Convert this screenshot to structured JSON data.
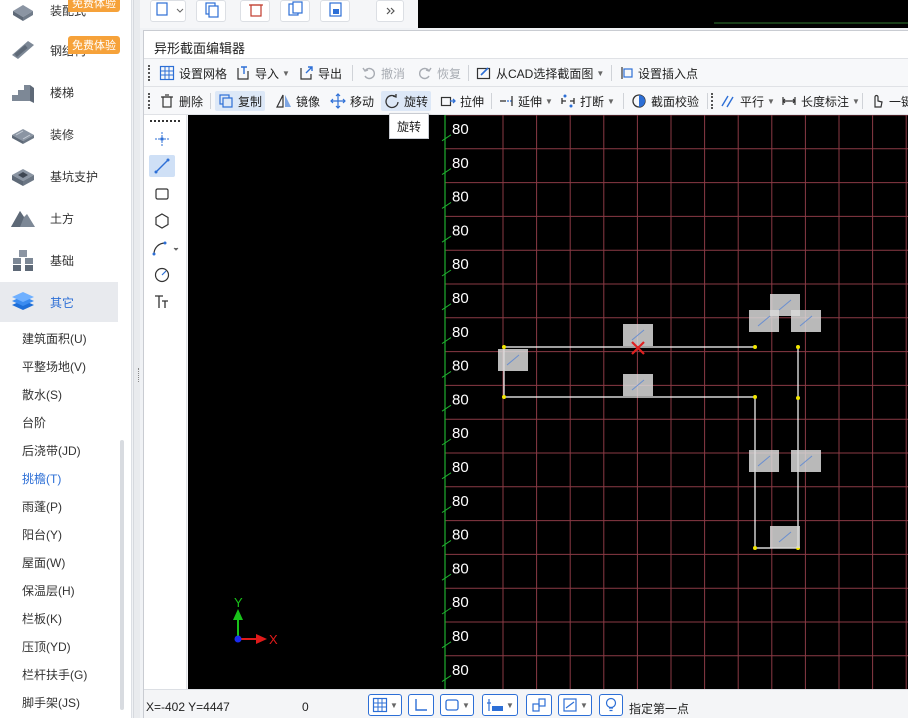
{
  "sidebar": {
    "categories": [
      {
        "label": "装配式",
        "badge": "免费体验",
        "icon": "prefab-icon"
      },
      {
        "label": "钢结构",
        "badge": "免费体验",
        "icon": "steel-icon"
      },
      {
        "label": "楼梯",
        "icon": "stairs-icon"
      },
      {
        "label": "装修",
        "icon": "decoration-icon"
      },
      {
        "label": "基坑支护",
        "icon": "foundation-pit-icon"
      },
      {
        "label": "土方",
        "icon": "earthwork-icon"
      },
      {
        "label": "基础",
        "icon": "foundation-icon"
      },
      {
        "label": "其它",
        "icon": "layers-icon",
        "active": true
      }
    ],
    "sub_items": [
      {
        "label": "建筑面积(U)"
      },
      {
        "label": "平整场地(V)"
      },
      {
        "label": "散水(S)"
      },
      {
        "label": "台阶"
      },
      {
        "label": "后浇带(JD)"
      },
      {
        "label": "挑檐(T)",
        "active": true
      },
      {
        "label": "雨蓬(P)"
      },
      {
        "label": "阳台(Y)"
      },
      {
        "label": "屋面(W)"
      },
      {
        "label": "保温层(H)"
      },
      {
        "label": "栏板(K)"
      },
      {
        "label": "压顶(YD)"
      },
      {
        "label": "栏杆扶手(G)"
      },
      {
        "label": "脚手架(JS)"
      }
    ]
  },
  "editor": {
    "title": "异形截面编辑器",
    "toolbar1": {
      "grid": "设置网格",
      "import": "导入",
      "export": "导出",
      "undo": "撤消",
      "redo": "恢复",
      "from_cad": "从CAD选择截面图",
      "insert_point": "设置插入点"
    },
    "toolbar2": {
      "delete": "删除",
      "copy": "复制",
      "mirror": "镜像",
      "move": "移动",
      "rotate": "旋转",
      "stretch": "拉伸",
      "extend": "延伸",
      "break": "打断",
      "check": "截面校验",
      "parallel": "平行",
      "dimension": "长度标注",
      "one_key": "一键"
    },
    "tooltip": "旋转",
    "canvas": {
      "grid_label": "80",
      "row_count": 17,
      "axis_x": "X",
      "axis_y": "Y",
      "colors": {
        "background": "#000000",
        "grid": "#8a3a45",
        "ticks": "#1fae2f",
        "label": "#ffffff",
        "shape": "#ffffff",
        "vertex": "#f2e600",
        "snap_marker": "#e02020"
      }
    },
    "status": {
      "coord": "X=-402 Y=4447",
      "zero": "0",
      "prompt": "指定第一点"
    }
  }
}
